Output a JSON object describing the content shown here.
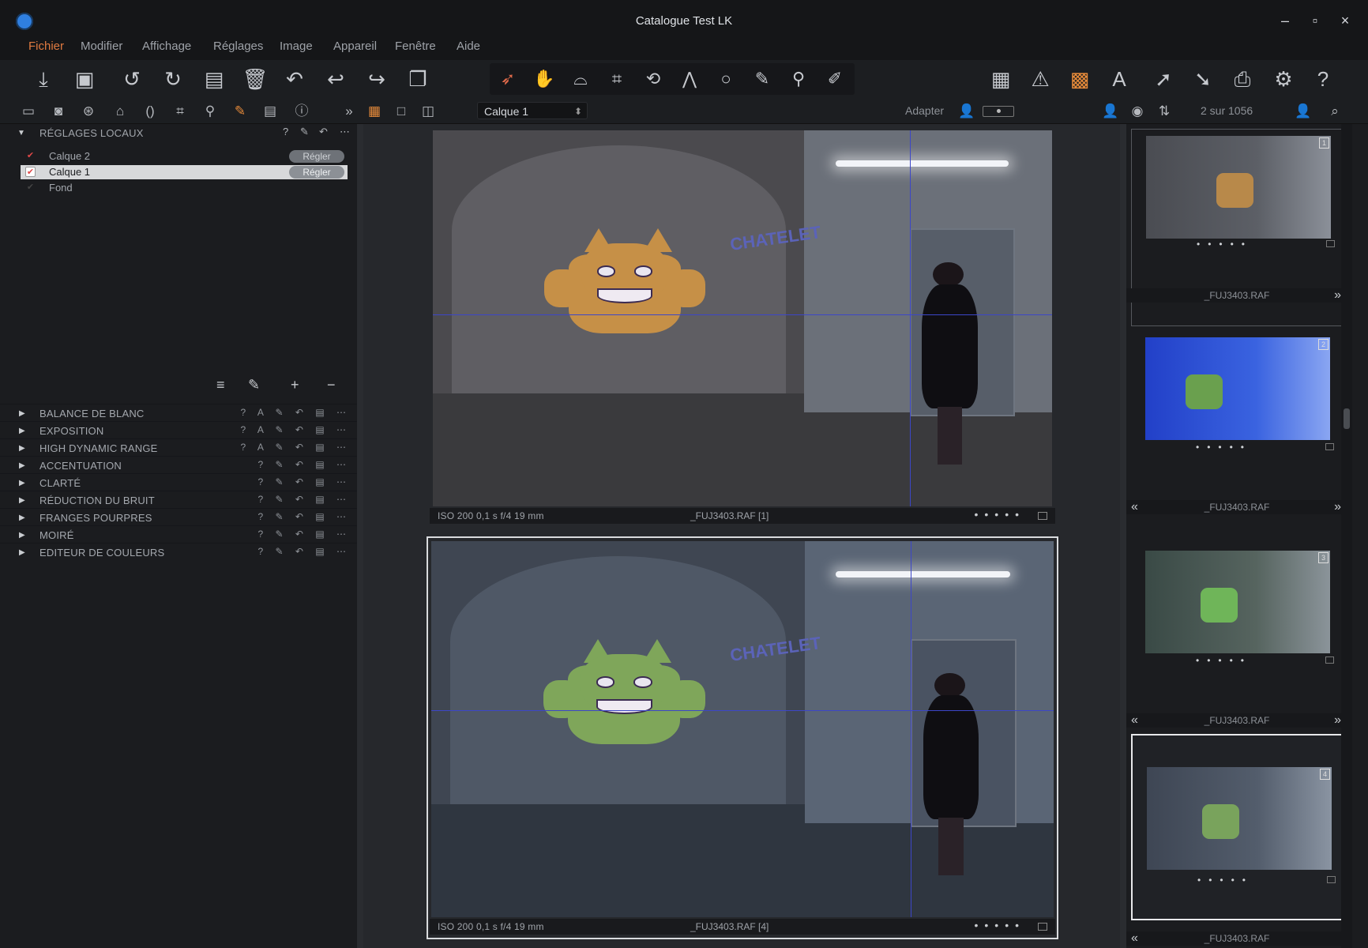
{
  "window": {
    "title": "Catalogue Test LK",
    "minimize": "–",
    "maximize": "▫",
    "close": "×"
  },
  "menu": [
    {
      "label": "Fichier",
      "active": true
    },
    {
      "label": "Modifier"
    },
    {
      "label": "Affichage"
    },
    {
      "label": "Réglages"
    },
    {
      "label": "Image"
    },
    {
      "label": "Appareil"
    },
    {
      "label": "Fenêtre"
    },
    {
      "label": "Aide"
    }
  ],
  "secbar": {
    "layer_select": "Calque 1",
    "adapter": "Adapter",
    "counter": "2 sur 1056",
    "more": "»"
  },
  "left_panel": {
    "title": "RÉGLAGES LOCAUX",
    "layers": [
      {
        "name": "Calque 2",
        "button": "Régler",
        "checked": true,
        "selected": false
      },
      {
        "name": "Calque 1",
        "button": "Régler",
        "checked": true,
        "selected": true
      },
      {
        "name": "Fond",
        "checked": false,
        "selected": false
      }
    ],
    "adjustments": [
      {
        "name": "BALANCE DE BLANC"
      },
      {
        "name": "EXPOSITION"
      },
      {
        "name": "HIGH DYNAMIC RANGE"
      },
      {
        "name": "ACCENTUATION"
      },
      {
        "name": "CLARTÉ"
      },
      {
        "name": "RÉDUCTION DU BRUIT"
      },
      {
        "name": "FRANGES POURPRES"
      },
      {
        "name": "MOIRÉ"
      },
      {
        "name": "EDITEUR DE COULEURS"
      }
    ]
  },
  "viewer": {
    "top": {
      "info": "ISO 200   0,1 s   f/4   19 mm",
      "file": "_FUJ3403.RAF [1]",
      "graffiti": "CHATELET"
    },
    "bottom": {
      "info": "ISO 200   0,1 s   f/4   19 mm",
      "file": "_FUJ3403.RAF [4]",
      "graffiti": "CHATELET"
    }
  },
  "filmstrip": {
    "thumbs": [
      {
        "num": "1",
        "name": "_FUJ3403.RAF"
      },
      {
        "num": "2",
        "name": "_FUJ3403.RAF"
      },
      {
        "num": "3",
        "name": "_FUJ3403.RAF"
      },
      {
        "num": "4",
        "name": "_FUJ3403.RAF"
      }
    ]
  },
  "colors": {
    "accent_orange": "#e07a40",
    "guide_line": "#3c46c8",
    "selection": "#d9dbde"
  }
}
